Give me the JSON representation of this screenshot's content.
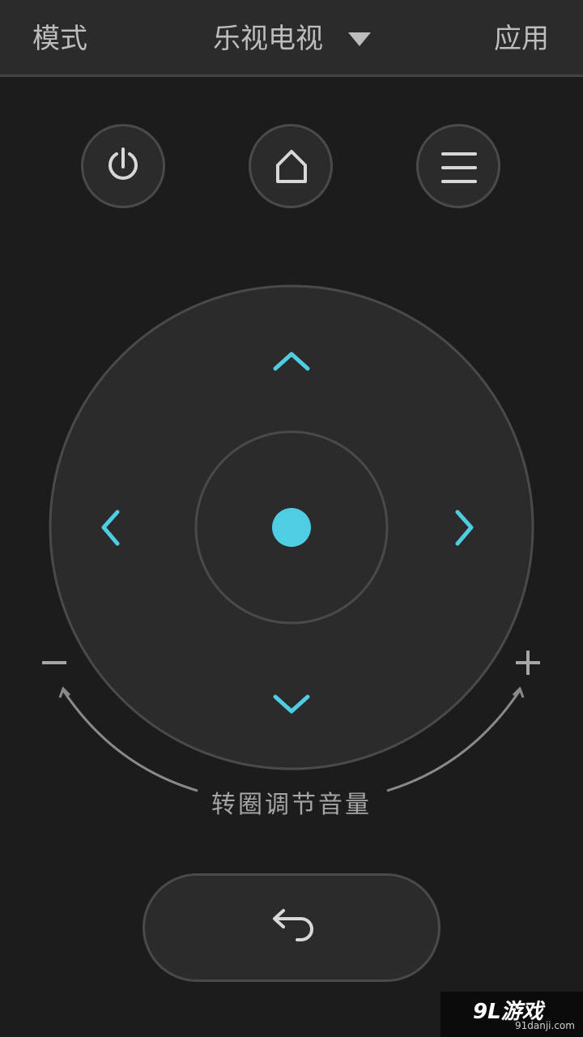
{
  "header": {
    "mode_label": "模式",
    "device_name": "乐视电视",
    "apps_label": "应用"
  },
  "buttons": {
    "power_icon": "power-icon",
    "home_icon": "home-icon",
    "menu_icon": "menu-icon",
    "back_icon": "back-arrow-icon"
  },
  "dpad": {
    "up_icon": "chevron-up-icon",
    "down_icon": "chevron-down-icon",
    "left_icon": "chevron-left-icon",
    "right_icon": "chevron-right-icon",
    "ok_icon": "ok-dot-icon"
  },
  "volume": {
    "minus": "−",
    "plus": "+",
    "hint": "转圈调节音量"
  },
  "watermark": {
    "logo": "9L游戏",
    "url": "91danji.com"
  },
  "colors": {
    "accent": "#4fcde3",
    "background": "#1c1c1d",
    "surface": "#2b2b2c",
    "text": "#bdbdbd"
  }
}
